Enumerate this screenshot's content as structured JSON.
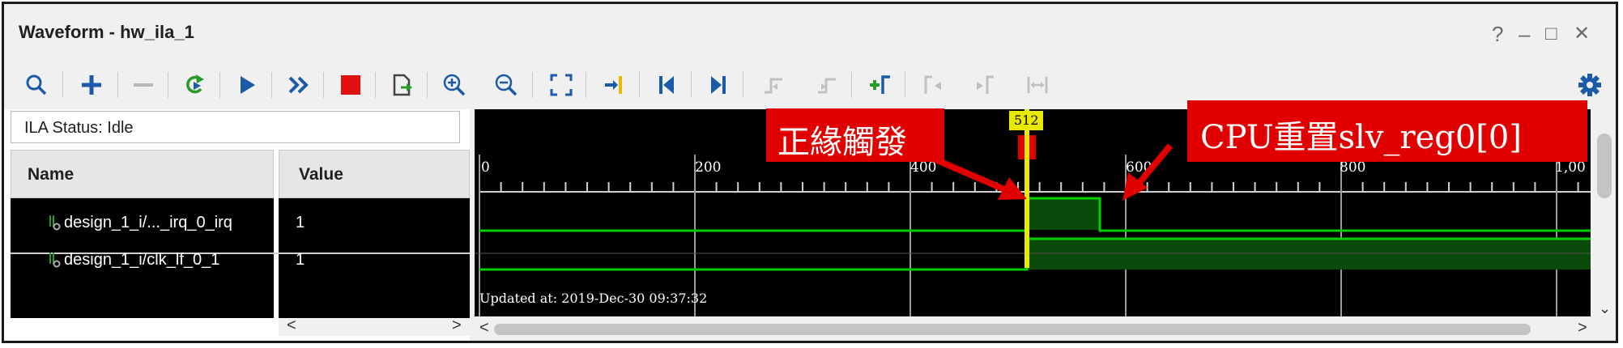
{
  "window": {
    "title": "Waveform - hw_ila_1",
    "help": "?",
    "minimize": "–",
    "maximize": "□",
    "close": "✕"
  },
  "toolbar": {
    "icons": [
      "search-icon",
      "add-icon",
      "remove-icon",
      "run-trigger-icon",
      "run-icon",
      "fast-forward-icon",
      "stop-icon",
      "export-icon",
      "zoom-in-icon",
      "zoom-out-icon",
      "zoom-fit-icon",
      "go-to-cursor-icon",
      "go-to-start-icon",
      "go-to-end-icon",
      "previous-transition-icon",
      "next-transition-icon",
      "add-marker-icon",
      "previous-marker-icon",
      "next-marker-icon",
      "swap-cursors-icon",
      "settings-icon"
    ]
  },
  "ila": {
    "status": "ILA Status: Idle"
  },
  "columns": {
    "name": "Name",
    "value": "Value"
  },
  "signals": [
    {
      "name": "design_1_i/..._irq_0_irq",
      "value": "1"
    },
    {
      "name": "design_1_i/clk_lf_0_1",
      "value": "1"
    }
  ],
  "waveform": {
    "ticks": [
      "0",
      "200",
      "400",
      "600",
      "800",
      "1,00"
    ],
    "cursor_label": "512",
    "updated": "Updated at: 2019-Dec-30 09:37:32"
  },
  "annotations": {
    "left": "正緣觸發",
    "right": "CPU重置slv_reg0[0]"
  },
  "colors": {
    "wave_green": "#00d000",
    "wave_fill": "#0a4a0a",
    "cursor": "#e8e800",
    "callout": "#e00000"
  }
}
